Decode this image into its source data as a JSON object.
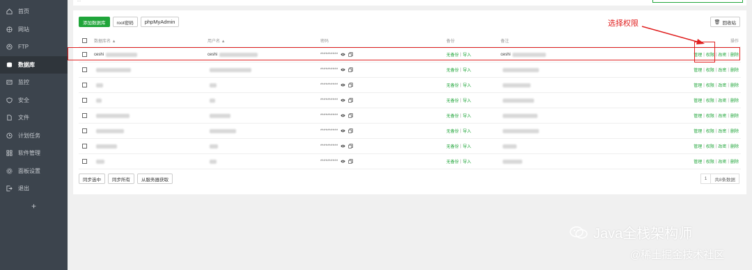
{
  "sidebar": {
    "items": [
      {
        "label": "首页",
        "icon": "home-icon"
      },
      {
        "label": "网站",
        "icon": "globe-icon"
      },
      {
        "label": "FTP",
        "icon": "ftp-icon"
      },
      {
        "label": "数据库",
        "icon": "database-icon",
        "active": true
      },
      {
        "label": "监控",
        "icon": "monitor-icon"
      },
      {
        "label": "安全",
        "icon": "shield-icon"
      },
      {
        "label": "文件",
        "icon": "file-icon"
      },
      {
        "label": "计划任务",
        "icon": "clock-icon"
      },
      {
        "label": "软件管理",
        "icon": "grid-icon"
      },
      {
        "label": "面板设置",
        "icon": "gear-icon"
      },
      {
        "label": "退出",
        "icon": "logout-icon"
      }
    ],
    "add_label": "+"
  },
  "topbar": {
    "crumb": "..."
  },
  "toolbar": {
    "add_db": "添加数据库",
    "root_pwd": "root密码",
    "phpmyadmin": "phpMyAdmin",
    "recycle": "回收站"
  },
  "table": {
    "headers": {
      "name": "数据库名 ▲",
      "user": "用户名 ▲",
      "password": "密码",
      "backup": "备份",
      "note": "备注",
      "actions": "操作"
    },
    "rows": [
      {
        "name": "ceshi",
        "user": "ceshi",
        "password": "**********",
        "backup": "无备份",
        "import": "导入",
        "note": "ceshi",
        "m": "管理",
        "p": "权限",
        "e": "改密",
        "d": "删除"
      },
      {
        "name": "",
        "user": "",
        "password": "**********",
        "backup": "无备份",
        "import": "导入",
        "note": "",
        "m": "管理",
        "p": "权限",
        "e": "改密",
        "d": "删除"
      },
      {
        "name": "",
        "user": "",
        "password": "**********",
        "backup": "无备份",
        "import": "导入",
        "note": "",
        "m": "管理",
        "p": "权限",
        "e": "改密",
        "d": "删除"
      },
      {
        "name": "",
        "user": "",
        "password": "**********",
        "backup": "无备份",
        "import": "导入",
        "note": "",
        "m": "管理",
        "p": "权限",
        "e": "改密",
        "d": "删除"
      },
      {
        "name": "",
        "user": "",
        "password": "**********",
        "backup": "无备份",
        "import": "导入",
        "note": "",
        "m": "管理",
        "p": "权限",
        "e": "改密",
        "d": "删除"
      },
      {
        "name": "",
        "user": "",
        "password": "**********",
        "backup": "无备份",
        "import": "导入",
        "note": "",
        "m": "管理",
        "p": "权限",
        "e": "改密",
        "d": "删除"
      },
      {
        "name": "",
        "user": "",
        "password": "**********",
        "backup": "无备份",
        "import": "导入",
        "note": "",
        "m": "管理",
        "p": "权限",
        "e": "改密",
        "d": "删除"
      },
      {
        "name": "",
        "user": "",
        "password": "**********",
        "backup": "无备份",
        "import": "导入",
        "note": "",
        "m": "管理",
        "p": "权限",
        "e": "改密",
        "d": "删除"
      }
    ]
  },
  "footer": {
    "sync_selected": "同步选中",
    "sync_all": "同步所有",
    "fetch_server": "从服务器获取",
    "page": "1",
    "total": "共8条数据"
  },
  "annotation": {
    "text": "选择权限"
  },
  "watermark": {
    "title": "Java全栈架构师",
    "sub": "@稀土掘金技术社区"
  },
  "colors": {
    "accent": "#20a53a",
    "annotation": "#e02020",
    "sidebar": "#3c444d"
  }
}
